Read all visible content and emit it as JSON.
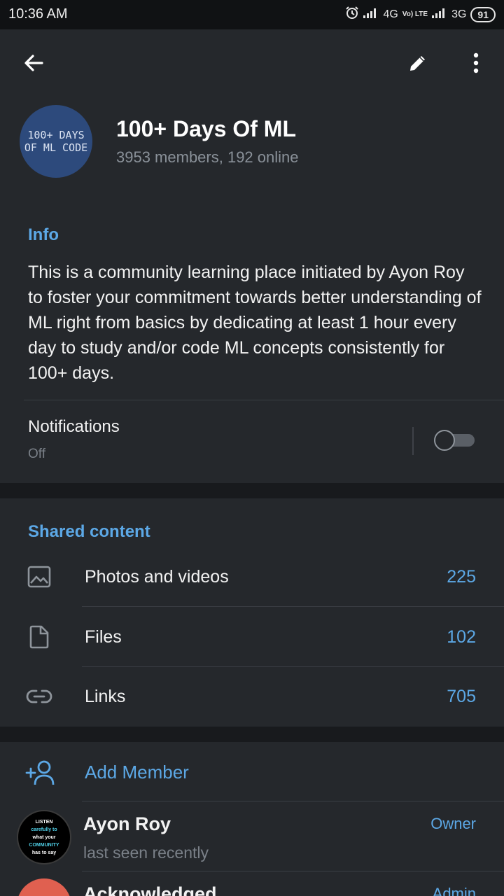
{
  "status_bar": {
    "time": "10:36 AM",
    "network1": "4G",
    "volte": "Vo) LTE",
    "network2": "3G",
    "battery": "91"
  },
  "header": {
    "avatar_lines": [
      "100+ DAYS",
      "OF ML CODE"
    ],
    "title": "100+ Days Of ML",
    "subtitle": "3953 members, 192 online",
    "icons": [
      "arrow-left-icon",
      "pencil-icon",
      "more-vertical-icon"
    ]
  },
  "info": {
    "label": "Info",
    "text": "This is a community learning place initiated by Ayon Roy to foster your commitment towards better understanding of ML right from basics by dedicating at least 1 hour every day to study and/or code ML concepts consistently for 100+ days.",
    "notifications_title": "Notifications",
    "notifications_state": "Off",
    "notifications_enabled": false
  },
  "shared": {
    "label": "Shared content",
    "items": [
      {
        "label": "Photos and videos",
        "count": "225",
        "icon": "image-icon"
      },
      {
        "label": "Files",
        "count": "102",
        "icon": "file-icon"
      },
      {
        "label": "Links",
        "count": "705",
        "icon": "link-icon"
      }
    ]
  },
  "members": {
    "add_label": "Add Member",
    "list": [
      {
        "name": "Ayon Roy",
        "status": "last seen recently",
        "role": "Owner",
        "avatar_text": [
          "LISTEN",
          "carefully to",
          "what your",
          "COMMUNITY",
          "has to say"
        ]
      },
      {
        "name": "Acknowledged",
        "status": "",
        "role": "Admin"
      }
    ]
  },
  "colors": {
    "accent": "#5ca8e6",
    "header_bg": "#25282c",
    "page_bg": "#1d2024"
  }
}
